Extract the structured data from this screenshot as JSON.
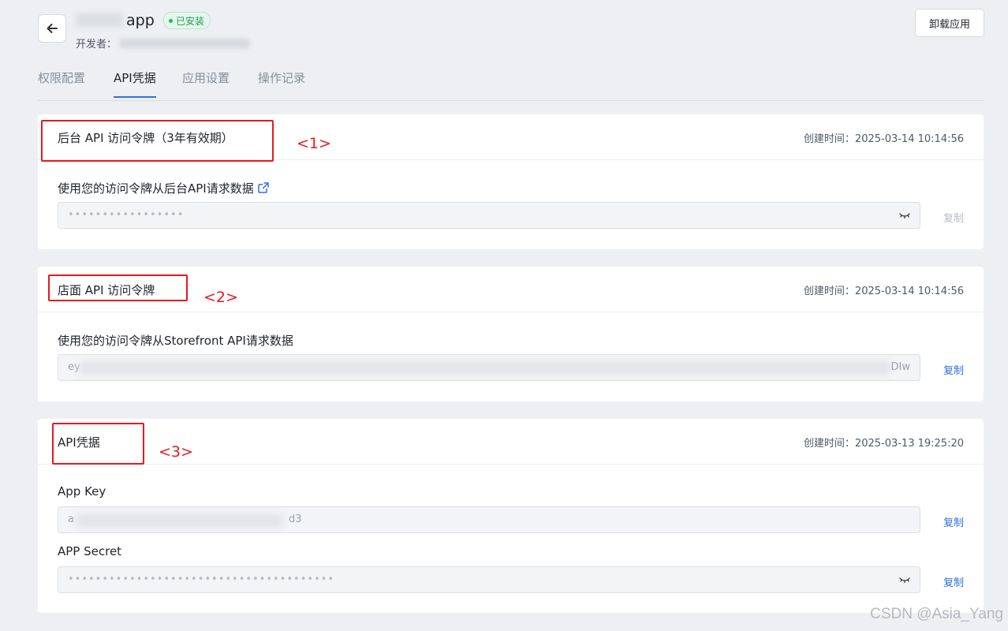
{
  "header": {
    "app_name": "app",
    "installed_badge": "已安装",
    "developer_label": "开发者：",
    "uninstall_label": "卸载应用"
  },
  "tabs": [
    {
      "label": "权限配置",
      "active": false
    },
    {
      "label": "API凭据",
      "active": true
    },
    {
      "label": "应用设置",
      "active": false
    },
    {
      "label": "操作记录",
      "active": false
    }
  ],
  "cards": {
    "admin": {
      "title": "后台 API 访问令牌（3年有效期）",
      "created": "创建时间：2025-03-14 10:14:56",
      "annotation": "<1>",
      "field_label": "使用您的访问令牌从后台API请求数据",
      "value": "•••••••••••••••••",
      "copy_label": "复制"
    },
    "storefront": {
      "title": "店面 API 访问令牌",
      "created": "创建时间：2025-03-14 10:14:56",
      "annotation": "<2>",
      "field_label": "使用您的访问令牌从Storefront API请求数据",
      "value": "ey",
      "value_end": "DIw",
      "copy_label": "复制"
    },
    "credentials": {
      "title": "API凭据",
      "created": "创建时间：2025-03-13 19:25:20",
      "annotation": "<3>",
      "app_key_label": "App Key",
      "app_key_value": "a",
      "app_key_end": "d3",
      "app_secret_label": "APP Secret",
      "app_secret_value": "•••••••••••••••••••••••••••••••••••••••",
      "copy_label": "复制"
    }
  },
  "watermark": "CSDN @Asia_Yang",
  "colors": {
    "accent": "#2f6fe4",
    "annotation_red": "#e8191f",
    "badge_green": "#1f9d55",
    "background": "#edeff3"
  }
}
